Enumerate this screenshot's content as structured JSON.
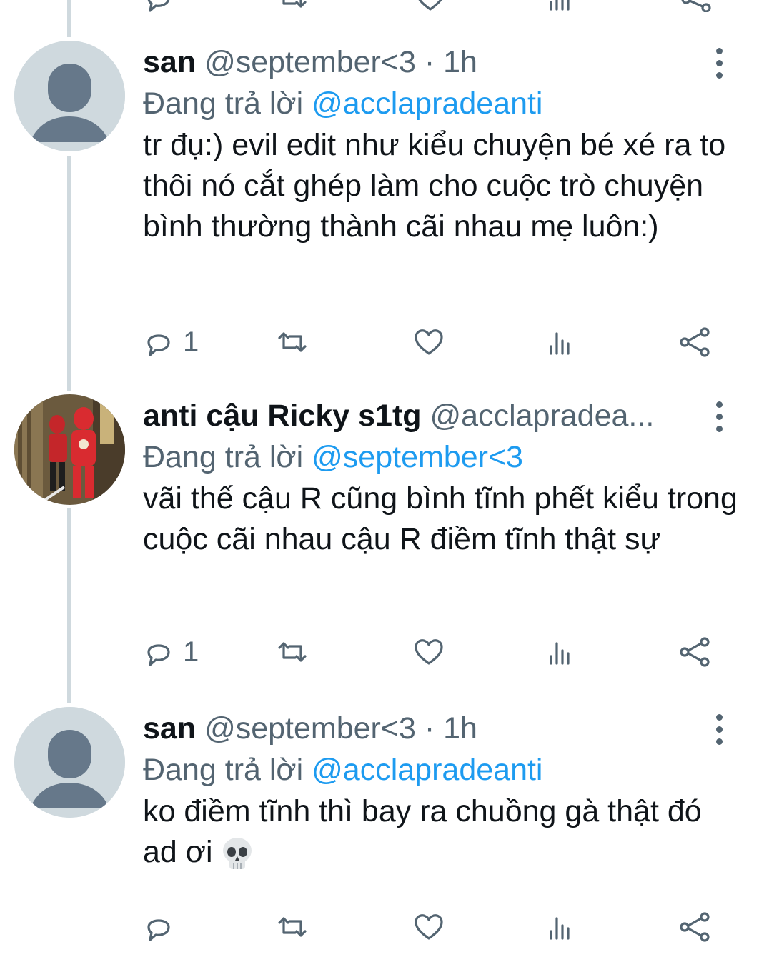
{
  "tweets": [
    {
      "name": "san",
      "handle": "@september<3",
      "dot": "·",
      "time": "1h",
      "reply_prefix": "Đang trả lời",
      "reply_to": "@acclapradeanti",
      "text": "tr đụ:) evil edit như kiểu chuyện bé xé ra to thôi nó cắt ghép làm cho cuộc trò chuyện bình thường thành cãi nhau mẹ luôn:)",
      "reply_count": "1",
      "avatar_icon": "default-avatar-icon"
    },
    {
      "name": "anti cậu Ricky s1tg",
      "handle": "@acclapradea...",
      "dot": "",
      "time": "",
      "reply_prefix": "Đang trả lời",
      "reply_to": "@september<3",
      "text": "vãi thế cậu R cũng bình tĩnh phết kiểu trong cuộc cãi nhau cậu R điềm tĩnh thật sự",
      "reply_count": "1",
      "avatar_icon": "profile-photo"
    },
    {
      "name": "san",
      "handle": "@september<3",
      "dot": "·",
      "time": "1h",
      "reply_prefix": "Đang trả lời",
      "reply_to": "@acclapradeanti",
      "text": "ko điềm tĩnh thì bay ra chuồng gà thật đó ad ơi",
      "emoji": "skull-emoji",
      "reply_count": "",
      "avatar_icon": "default-avatar-icon"
    }
  ],
  "colors": {
    "text": "#0f1419",
    "secondary": "#536471",
    "mention": "#1d9bf0",
    "thread_line": "#cfd9de",
    "avatar_bg": "#cfd9de",
    "avatar_fg": "#66788a"
  },
  "icons": [
    "reply-icon",
    "retweet-icon",
    "like-icon",
    "views-icon",
    "share-icon",
    "more-icon"
  ]
}
